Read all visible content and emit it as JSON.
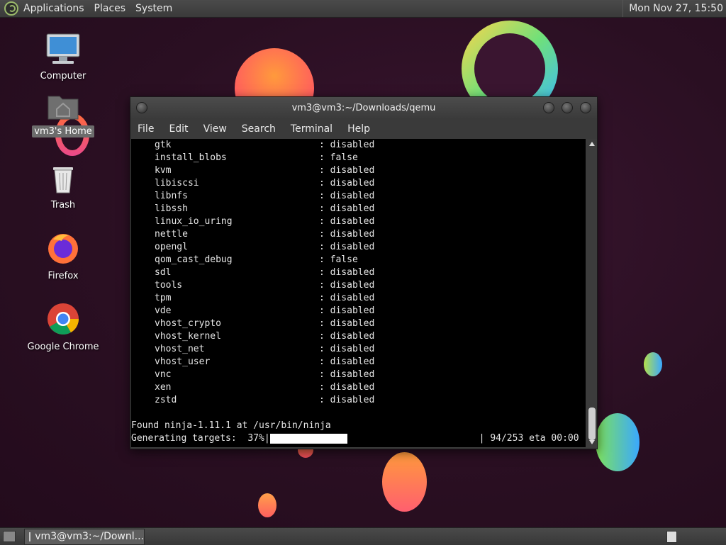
{
  "top_panel": {
    "menu": [
      "Applications",
      "Places",
      "System"
    ],
    "clock": "Mon Nov 27, 15:50"
  },
  "desktop": {
    "icons": [
      {
        "label": "Computer",
        "icon": "computer-icon"
      },
      {
        "label": "vm3's Home",
        "icon": "home-folder-icon"
      },
      {
        "label": "Trash",
        "icon": "trash-icon"
      },
      {
        "label": "Firefox",
        "icon": "firefox-icon"
      },
      {
        "label": "Google Chrome",
        "icon": "chrome-icon"
      }
    ]
  },
  "terminal": {
    "title": "vm3@vm3:~/Downloads/qemu",
    "menu": [
      "File",
      "Edit",
      "View",
      "Search",
      "Terminal",
      "Help"
    ],
    "config_rows": [
      {
        "key": "gtk",
        "value": ": disabled"
      },
      {
        "key": "install_blobs",
        "value": ": false"
      },
      {
        "key": "kvm",
        "value": ": disabled"
      },
      {
        "key": "libiscsi",
        "value": ": disabled"
      },
      {
        "key": "libnfs",
        "value": ": disabled"
      },
      {
        "key": "libssh",
        "value": ": disabled"
      },
      {
        "key": "linux_io_uring",
        "value": ": disabled"
      },
      {
        "key": "nettle",
        "value": ": disabled"
      },
      {
        "key": "opengl",
        "value": ": disabled"
      },
      {
        "key": "qom_cast_debug",
        "value": ": false"
      },
      {
        "key": "sdl",
        "value": ": disabled"
      },
      {
        "key": "tools",
        "value": ": disabled"
      },
      {
        "key": "tpm",
        "value": ": disabled"
      },
      {
        "key": "vde",
        "value": ": disabled"
      },
      {
        "key": "vhost_crypto",
        "value": ": disabled"
      },
      {
        "key": "vhost_kernel",
        "value": ": disabled"
      },
      {
        "key": "vhost_net",
        "value": ": disabled"
      },
      {
        "key": "vhost_user",
        "value": ": disabled"
      },
      {
        "key": "vnc",
        "value": ": disabled"
      },
      {
        "key": "xen",
        "value": ": disabled"
      },
      {
        "key": "zstd",
        "value": ": disabled"
      }
    ],
    "found_line": "Found ninja-1.11.1 at /usr/bin/ninja",
    "progress": {
      "label": "Generating targets:  37%|",
      "percent": 37,
      "tail": "| 94/253 eta 00:00"
    }
  },
  "taskbar": {
    "task_label": "vm3@vm3:~/Downl..."
  }
}
